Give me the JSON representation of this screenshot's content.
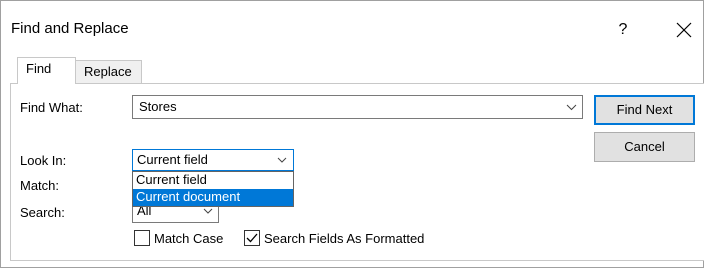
{
  "dialog": {
    "title": "Find and Replace",
    "help_label": "?",
    "close_icon": "close-icon"
  },
  "tabs": [
    {
      "label": "Find",
      "active": true
    },
    {
      "label": "Replace",
      "active": false
    }
  ],
  "find_what": {
    "label": "Find What:",
    "value": "Stores"
  },
  "look_in": {
    "label": "Look In:",
    "value": "Current field",
    "options": [
      "Current field",
      "Current document"
    ],
    "highlighted_option": "Current document"
  },
  "match": {
    "label": "Match:"
  },
  "search": {
    "label": "Search:",
    "value": "All"
  },
  "checkboxes": {
    "match_case": {
      "label": "Match Case",
      "checked": false
    },
    "search_formatted": {
      "label": "Search Fields As Formatted",
      "checked": true
    }
  },
  "buttons": {
    "find_next": "Find Next",
    "cancel": "Cancel"
  },
  "colors": {
    "accent": "#0078d7",
    "button_bg": "#e1e1e1"
  }
}
